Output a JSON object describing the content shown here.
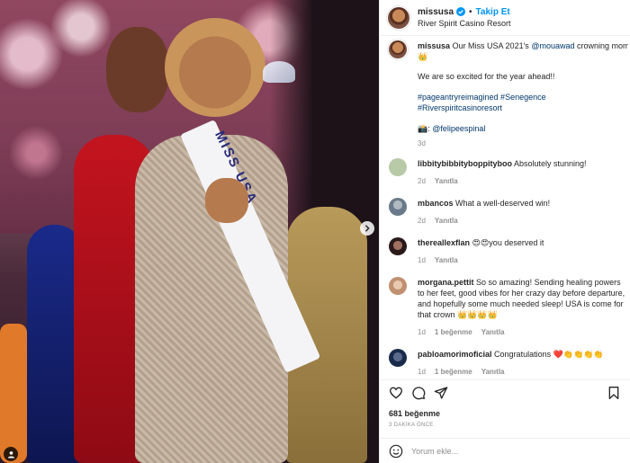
{
  "post": {
    "username": "missusa",
    "follow_label": "Takip Et",
    "location": "River Spirit Casino Resort",
    "caption": {
      "text_main": "Our Miss USA 2021's",
      "mention": "@mouawad",
      "text_after": "crowning momen",
      "emoji": "👑",
      "line2": "We are so excited for the year ahead!!",
      "hashtags": "#pageantryreimagined #Senegence #Riverspiritcasinoresort",
      "camera_emoji": "📸:",
      "photographer": "@felipeespinal",
      "age": "3d"
    },
    "sash_text": "MISS USA",
    "likes": "681 beğenme",
    "time_ago": "3 DAKİKA ÖNCE",
    "comment_placeholder": "Yorum ekle...",
    "reply_label": "Yanıtla"
  },
  "comments": [
    {
      "user": "libbitybibbityboppityboo",
      "text": "Absolutely stunning!",
      "age": "2d",
      "likes": "",
      "avatar_color": "#b8c9a8"
    },
    {
      "user": "mbancos",
      "text": "What a well-deserved win!",
      "age": "2d",
      "likes": "",
      "avatar_color": "#7a8a9a"
    },
    {
      "user": "thereallexflan",
      "text": "😍😍you deserved it",
      "age": "1d",
      "likes": "",
      "avatar_color": "#4a3a3a"
    },
    {
      "user": "morgana.pettit",
      "text": "So so amazing! Sending healing powers to her feet, good vibes for her crazy day before departure, and hopefully some much needed sleep! USA is come for that crown 👑👑👑👑",
      "age": "1d",
      "likes": "1 beğenme",
      "avatar_color": "#d8b8a0"
    },
    {
      "user": "pabloamorimoficial",
      "text": "Congratulations ❤️👏👏👏👏",
      "age": "1d",
      "likes": "1 beğenme",
      "avatar_color": "#3a4a6a"
    }
  ],
  "colors": {
    "accent": "#0095f6",
    "link": "#00376b",
    "muted": "#8e8e8e",
    "border": "#efefef"
  },
  "icons": [
    "verified-badge-icon",
    "chevron-right-icon",
    "user-tag-icon",
    "heart-icon",
    "comment-icon",
    "share-icon",
    "bookmark-icon",
    "emoji-icon"
  ]
}
